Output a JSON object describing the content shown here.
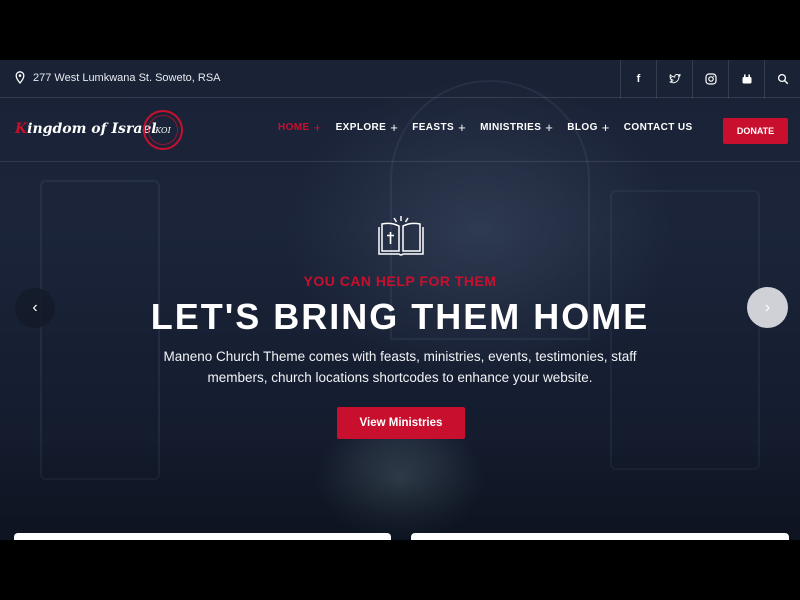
{
  "topbar": {
    "address": "277 West Lumkwana St. Soweto, RSA",
    "socials": [
      {
        "icon": "facebook-icon",
        "glyph": "f"
      },
      {
        "icon": "twitter-icon",
        "glyph": ""
      },
      {
        "icon": "instagram-icon",
        "glyph": ""
      },
      {
        "icon": "youtube-icon",
        "glyph": ""
      },
      {
        "icon": "search-icon",
        "glyph": ""
      }
    ]
  },
  "brand": {
    "logo_initial": "K",
    "logo_rest": "ingdom of Israel",
    "badge": "KOI"
  },
  "nav": {
    "items": [
      {
        "label": "HOME",
        "plus": "+"
      },
      {
        "label": "EXPLORE",
        "plus": "+"
      },
      {
        "label": "FEASTS",
        "plus": "+"
      },
      {
        "label": "MINISTRIES",
        "plus": "+"
      },
      {
        "label": "BLOG",
        "plus": "+"
      },
      {
        "label": "CONTACT US",
        "plus": ""
      }
    ],
    "donate": "DONATE"
  },
  "hero": {
    "icon": "bible-icon",
    "eyebrow": "YOU CAN HELP FOR THEM",
    "headline": "LET'S BRING THEM HOME",
    "subtext": "Maneno Church Theme comes with feasts, ministries, events, testimonies, staff members, church locations shortcodes to enhance your website.",
    "cta": "View Ministries",
    "prev_glyph": "‹",
    "next_glyph": "›"
  },
  "colors": {
    "accent": "#c8102e",
    "background": "#1a2236"
  }
}
